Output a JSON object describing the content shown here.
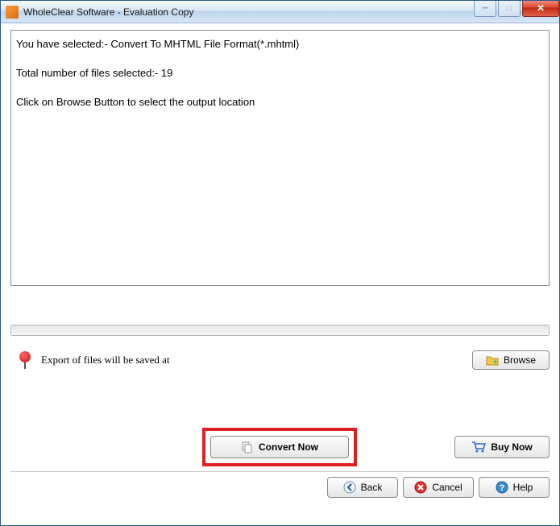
{
  "titlebar": {
    "title": "WholeClear Software - Evaluation Copy"
  },
  "info": {
    "line1": "You have selected:- Convert To MHTML File Format(*.mhtml)",
    "line2": "Total number of files selected:- 19",
    "line3": "Click on Browse Button to select the output location"
  },
  "export": {
    "label": "Export of files will be saved at",
    "browse": "Browse"
  },
  "actions": {
    "convert": "Convert Now",
    "buy": "Buy Now"
  },
  "footer": {
    "back": "Back",
    "cancel": "Cancel",
    "help": "Help"
  }
}
